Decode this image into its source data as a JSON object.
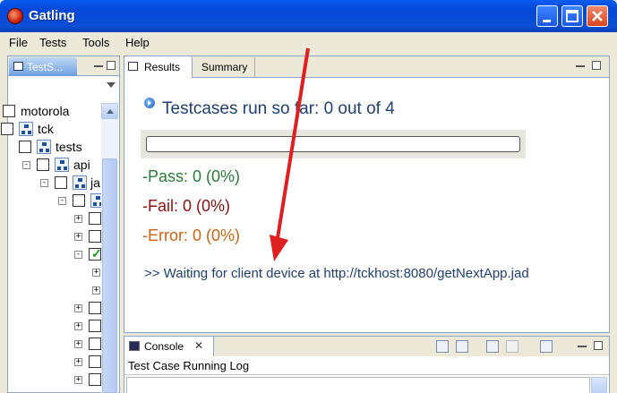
{
  "window": {
    "title": "Gatling"
  },
  "menu": [
    "File",
    "Tests",
    "Tools",
    "Help"
  ],
  "tree_panel": {
    "tab_label": "TestS...",
    "items": [
      {
        "label": "motorola",
        "type": "package"
      },
      {
        "label": "tck",
        "type": "package"
      },
      {
        "label": "tests",
        "type": "package"
      },
      {
        "label": "api",
        "type": "package"
      },
      {
        "label": "ja",
        "type": "package"
      }
    ],
    "checked_row": 6
  },
  "results_panel": {
    "tabs": [
      "Results",
      "Summary"
    ],
    "heading": "Testcases run so far: 0 out of 4",
    "progress": {
      "completed": 0,
      "total": 4
    },
    "pass": "-Pass: 0 (0%)",
    "fail": "-Fail: 0 (0%)",
    "error": "-Error: 0 (0%)",
    "waiting": ">> Waiting for client device at http://tckhost:8080/getNextApp.jad"
  },
  "console_panel": {
    "tab_label": "Console",
    "log_title": "Test Case Running Log"
  },
  "colors": {
    "pass": "#2a7a3a",
    "fail": "#8a1010",
    "error": "#c86414",
    "annotation_arrow": "#e02020"
  },
  "icons": {
    "app": "gatling-app-icon",
    "results_tab": "results-tab-icon",
    "testcase": "testcase-play-icon"
  }
}
